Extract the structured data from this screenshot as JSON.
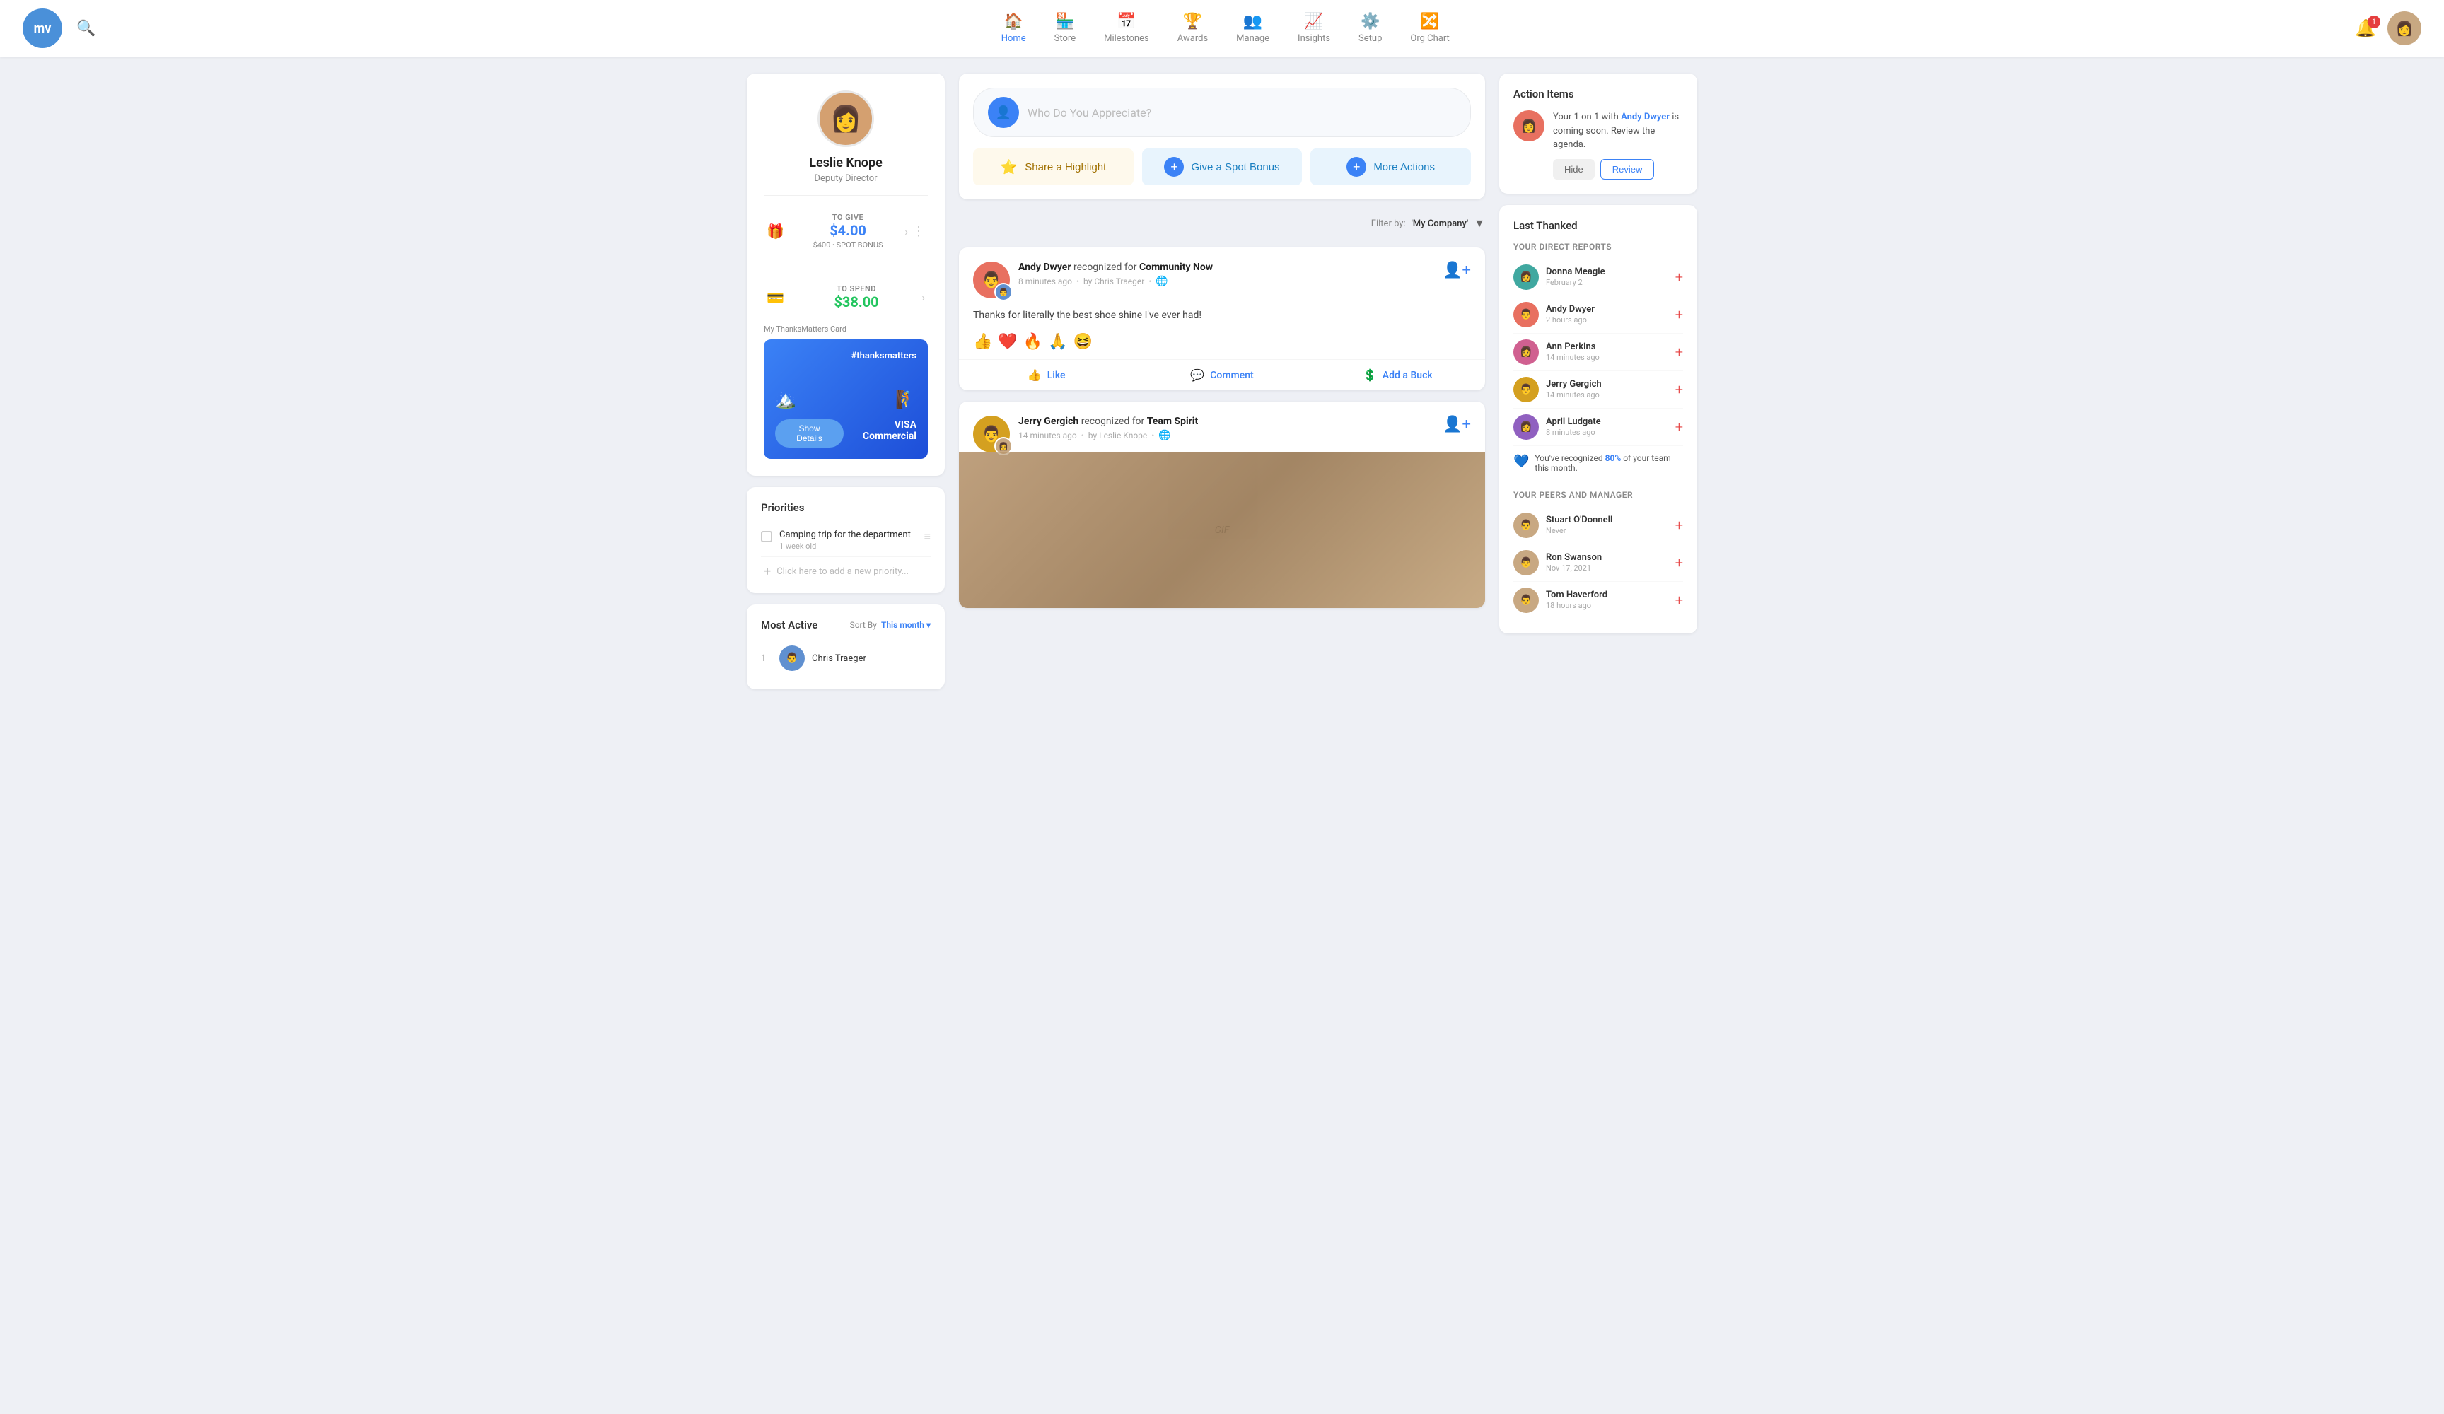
{
  "app": {
    "logo_initials": "mv"
  },
  "nav": {
    "items": [
      {
        "id": "home",
        "label": "Home",
        "icon": "🏠",
        "active": true
      },
      {
        "id": "store",
        "label": "Store",
        "icon": "🏪",
        "active": false
      },
      {
        "id": "milestones",
        "label": "Milestones",
        "icon": "📅",
        "active": false
      },
      {
        "id": "awards",
        "label": "Awards",
        "icon": "🏆",
        "active": false
      },
      {
        "id": "manage",
        "label": "Manage",
        "icon": "👥",
        "active": false
      },
      {
        "id": "insights",
        "label": "Insights",
        "icon": "📈",
        "active": false
      },
      {
        "id": "setup",
        "label": "Setup",
        "icon": "⚙️",
        "active": false
      },
      {
        "id": "org_chart",
        "label": "Org Chart",
        "icon": "🔀",
        "active": false
      }
    ],
    "notification_count": "1"
  },
  "profile": {
    "name": "Leslie Knope",
    "title": "Deputy Director",
    "to_give_label": "TO GIVE",
    "to_give_amount": "$4.00",
    "spot_bonus_label": "$400 · SPOT BONUS",
    "to_spend_label": "TO SPEND",
    "to_spend_amount": "$38.00",
    "card_label": "My ThanksMatters Card",
    "card_hashtag": "#thanksmatters",
    "show_details_label": "Show Details",
    "visa_label": "VISA Commercial"
  },
  "priorities": {
    "title": "Priorities",
    "items": [
      {
        "text": "Camping trip for the department",
        "age": "1 week old"
      }
    ],
    "add_placeholder": "Click here to add a new priority..."
  },
  "most_active": {
    "title": "Most Active",
    "sort_by_label": "Sort By",
    "sort_value": "This month",
    "items": [
      {
        "rank": "1",
        "name": "Chris Traeger"
      }
    ]
  },
  "appreciate": {
    "placeholder": "Who Do You Appreciate?",
    "share_highlight": "Share a Highlight",
    "give_spot_bonus": "Give a Spot Bonus",
    "more_actions": "More Actions"
  },
  "filter": {
    "label": "Filter by:",
    "value": "'My Company'",
    "arrow": "▼"
  },
  "feed": [
    {
      "id": "post1",
      "author": "Andy Dwyer",
      "action": "recognized for",
      "value": "Community Now",
      "time": "8 minutes ago",
      "by": "by Chris Traeger",
      "body": "Thanks for literally the best shoe shine I've ever had!",
      "reactions": [
        "👍",
        "❤️",
        "🔥",
        "🙏",
        "😆"
      ],
      "like_label": "Like",
      "comment_label": "Comment",
      "buck_label": "Add a Buck"
    },
    {
      "id": "post2",
      "author": "Jerry Gergich",
      "action": "recognized for",
      "value": "Team Spirit",
      "time": "14 minutes ago",
      "by": "by Leslie Knope",
      "body": "",
      "has_gif": true
    }
  ],
  "action_items": {
    "title": "Action Items",
    "item": {
      "text_pre": "Your 1 on 1 with ",
      "link_name": "Andy Dwyer",
      "text_post": " is coming soon. Review the agenda.",
      "hide_label": "Hide",
      "review_label": "Review"
    }
  },
  "last_thanked": {
    "title": "Last Thanked",
    "direct_reports_label": "Your Direct Reports",
    "reports": [
      {
        "name": "Donna Meagle",
        "time": "February 2",
        "av": "av-teal"
      },
      {
        "name": "Andy Dwyer",
        "time": "2 hours ago",
        "av": "av-orange"
      },
      {
        "name": "Ann Perkins",
        "time": "14 minutes ago",
        "av": "av-pink"
      },
      {
        "name": "Jerry Gergich",
        "time": "14 minutes ago",
        "av": "av-yellow"
      },
      {
        "name": "April Ludgate",
        "time": "8 minutes ago",
        "av": "av-purple"
      }
    ],
    "recognized_pct": "80%",
    "recognized_text_pre": "You've recognized ",
    "recognized_text_post": " of your team this month.",
    "peers_label": "Your Peers and Manager",
    "peers": [
      {
        "name": "Stuart O'Donnell",
        "time": "Never",
        "av": "av-brown"
      },
      {
        "name": "Ron Swanson",
        "time": "Nov 17, 2021",
        "av": "av-brown"
      },
      {
        "name": "Tom Haverford",
        "time": "18 hours ago",
        "av": "av-brown"
      }
    ]
  }
}
